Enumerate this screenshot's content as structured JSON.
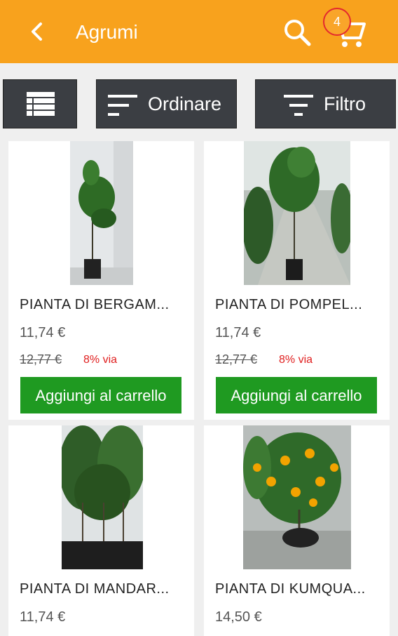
{
  "header": {
    "title": "Agrumi",
    "cart_count": "4",
    "back_icon": "chevron-left-icon",
    "search_icon": "search-icon",
    "cart_icon": "cart-icon"
  },
  "toolbar": {
    "view_icon": "list-view-icon",
    "sort_label": "Ordinare",
    "filter_label": "Filtro"
  },
  "products": [
    {
      "name": "PIANTA DI BERGAM...",
      "price": "11,74 €",
      "old_price": "12,77 €",
      "discount": "8% via",
      "button": "Aggiungi al carrello"
    },
    {
      "name": "PIANTA DI POMPEL...",
      "price": "11,74 €",
      "old_price": "12,77 €",
      "discount": "8% via",
      "button": "Aggiungi al carrello"
    },
    {
      "name": "PIANTA DI MANDAR...",
      "price": "11,74 €"
    },
    {
      "name": "PIANTA DI KUMQUA...",
      "price": "14,50 €"
    }
  ],
  "colors": {
    "accent": "#f8a21d",
    "button": "#1f9a21",
    "discount": "#e02020",
    "toolbar": "#3b3e43"
  }
}
